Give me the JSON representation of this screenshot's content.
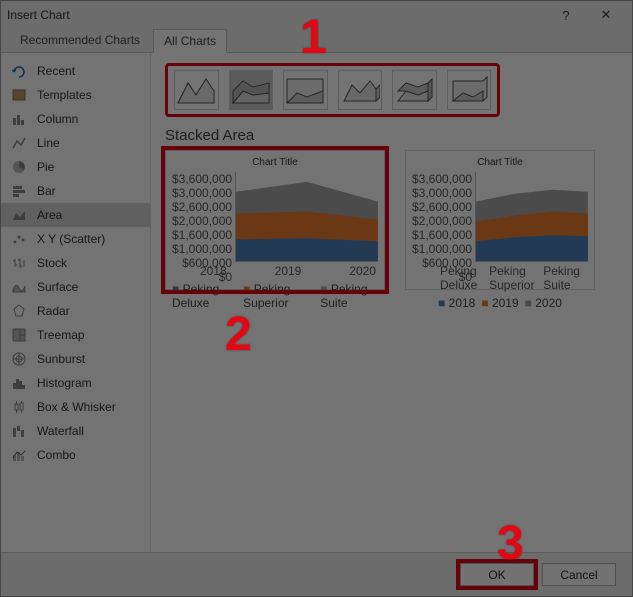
{
  "title": "Insert Chart",
  "tabs": {
    "recommended": "Recommended Charts",
    "all": "All Charts"
  },
  "sidebar": {
    "items": [
      {
        "label": "Recent"
      },
      {
        "label": "Templates"
      },
      {
        "label": "Column"
      },
      {
        "label": "Line"
      },
      {
        "label": "Pie"
      },
      {
        "label": "Bar"
      },
      {
        "label": "Area"
      },
      {
        "label": "X Y (Scatter)"
      },
      {
        "label": "Stock"
      },
      {
        "label": "Surface"
      },
      {
        "label": "Radar"
      },
      {
        "label": "Treemap"
      },
      {
        "label": "Sunburst"
      },
      {
        "label": "Histogram"
      },
      {
        "label": "Box & Whisker"
      },
      {
        "label": "Waterfall"
      },
      {
        "label": "Combo"
      }
    ]
  },
  "subtype_label": "Stacked Area",
  "preview": {
    "title": "Chart Title"
  },
  "chart_data": {
    "type": "area",
    "stacked": true,
    "categories": [
      "2018",
      "2019",
      "2020"
    ],
    "series": [
      {
        "name": "Peking Deluxe",
        "values": [
          900000,
          900000,
          800000
        ],
        "color": "#4f81bd"
      },
      {
        "name": "Peking Superior",
        "values": [
          1000000,
          1100000,
          900000
        ],
        "color": "#ed7d31"
      },
      {
        "name": "Peking Suite",
        "values": [
          900000,
          1200000,
          700000
        ],
        "color": "#a6a6a6"
      }
    ],
    "ylabel": "",
    "xlabel": "",
    "ylim": [
      0,
      3600000
    ],
    "yticks": [
      "$0",
      "$600,000",
      "$1,000,000",
      "$1,600,000",
      "$2,000,000",
      "$2,600,000",
      "$3,000,000",
      "$3,600,000"
    ],
    "title": "Chart Title"
  },
  "footer": {
    "ok": "OK",
    "cancel": "Cancel"
  },
  "markers": {
    "m1": "1",
    "m2": "2",
    "m3": "3"
  }
}
